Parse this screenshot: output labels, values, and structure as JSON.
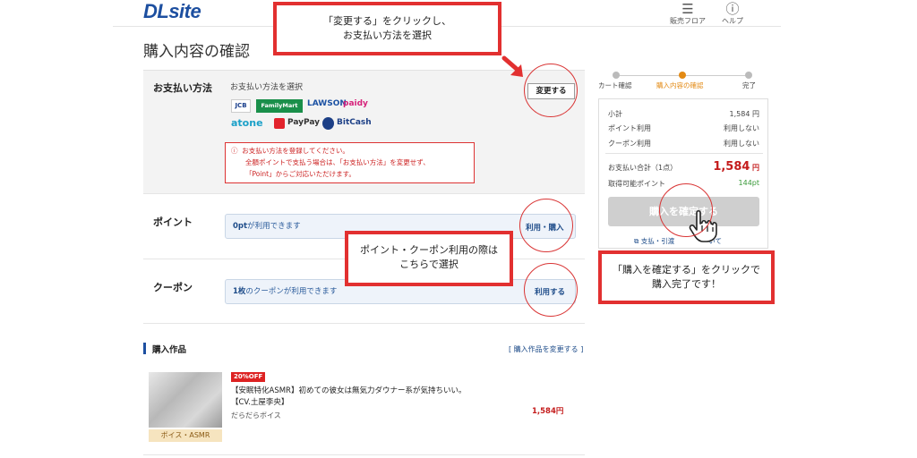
{
  "header": {
    "logo": "DLsite",
    "floor_label": "販売フロア",
    "help_label": "ヘルプ"
  },
  "page_title": "購入内容の確認",
  "payment": {
    "label": "お支払い方法",
    "prompt": "お支払い方法を選択",
    "brands": [
      "JCB",
      "FamilyMart",
      "LAWSON",
      "paidy",
      "atone",
      "PayPay",
      "BitCash"
    ],
    "change_button": "変更する",
    "error_line1": "お支払い方法を登録してください。",
    "error_line2": "全額ポイントで支払う場合は、「お支払い方法」を変更せず、",
    "error_line3": "「Point」からご対応いただけます。"
  },
  "point": {
    "label": "ポイント",
    "field_strong": "0pt",
    "field_text": "が利用できます",
    "link": "利用・購入"
  },
  "coupon": {
    "label": "クーポン",
    "field_strong": "1枚",
    "field_text": "のクーポンが利用できます",
    "link": "利用する"
  },
  "works": {
    "title": "購入作品",
    "change_link": "[ 購入作品を変更する ]",
    "item": {
      "badge": "20%OFF",
      "title_line1": "【安眠特化ASMR】初めての彼女は無気力ダウナー系が気持ちいい。",
      "title_line2": "【CV.土屋李央】",
      "circle": "だらだらボイス",
      "price": "1,584円",
      "category": "ボイス・ASMR"
    }
  },
  "steps": [
    "カート確認",
    "購入内容の確認",
    "完了"
  ],
  "summary": {
    "subtotal_label": "小計",
    "subtotal_value": "1,584 円",
    "point_label": "ポイント利用",
    "point_value": "利用しない",
    "coupon_label": "クーポン利用",
    "coupon_value": "利用しない",
    "total_label": "お支払い合計（1点）",
    "total_value": "1,584",
    "total_unit": "円",
    "earn_label": "取得可能ポイント",
    "earn_value": "144pt",
    "confirm_button": "購入を確定する",
    "pay_guide_head": "支払・引渡",
    "pay_guide_tail": "いて"
  },
  "annotations": {
    "top_line1": "「変更する」をクリックし、",
    "top_line2": "お支払い方法を選択",
    "middle_line1": "ポイント・クーポン利用の際は",
    "middle_line2": "こちらで選択",
    "right_line1": "「購入を確定する」をクリックで",
    "right_line2": "購入完了です！"
  },
  "colors": {
    "brand_blue": "#1d4fa0",
    "accent_red": "#e23030",
    "price_red": "#c41c1c",
    "step_active": "#e38a14"
  }
}
